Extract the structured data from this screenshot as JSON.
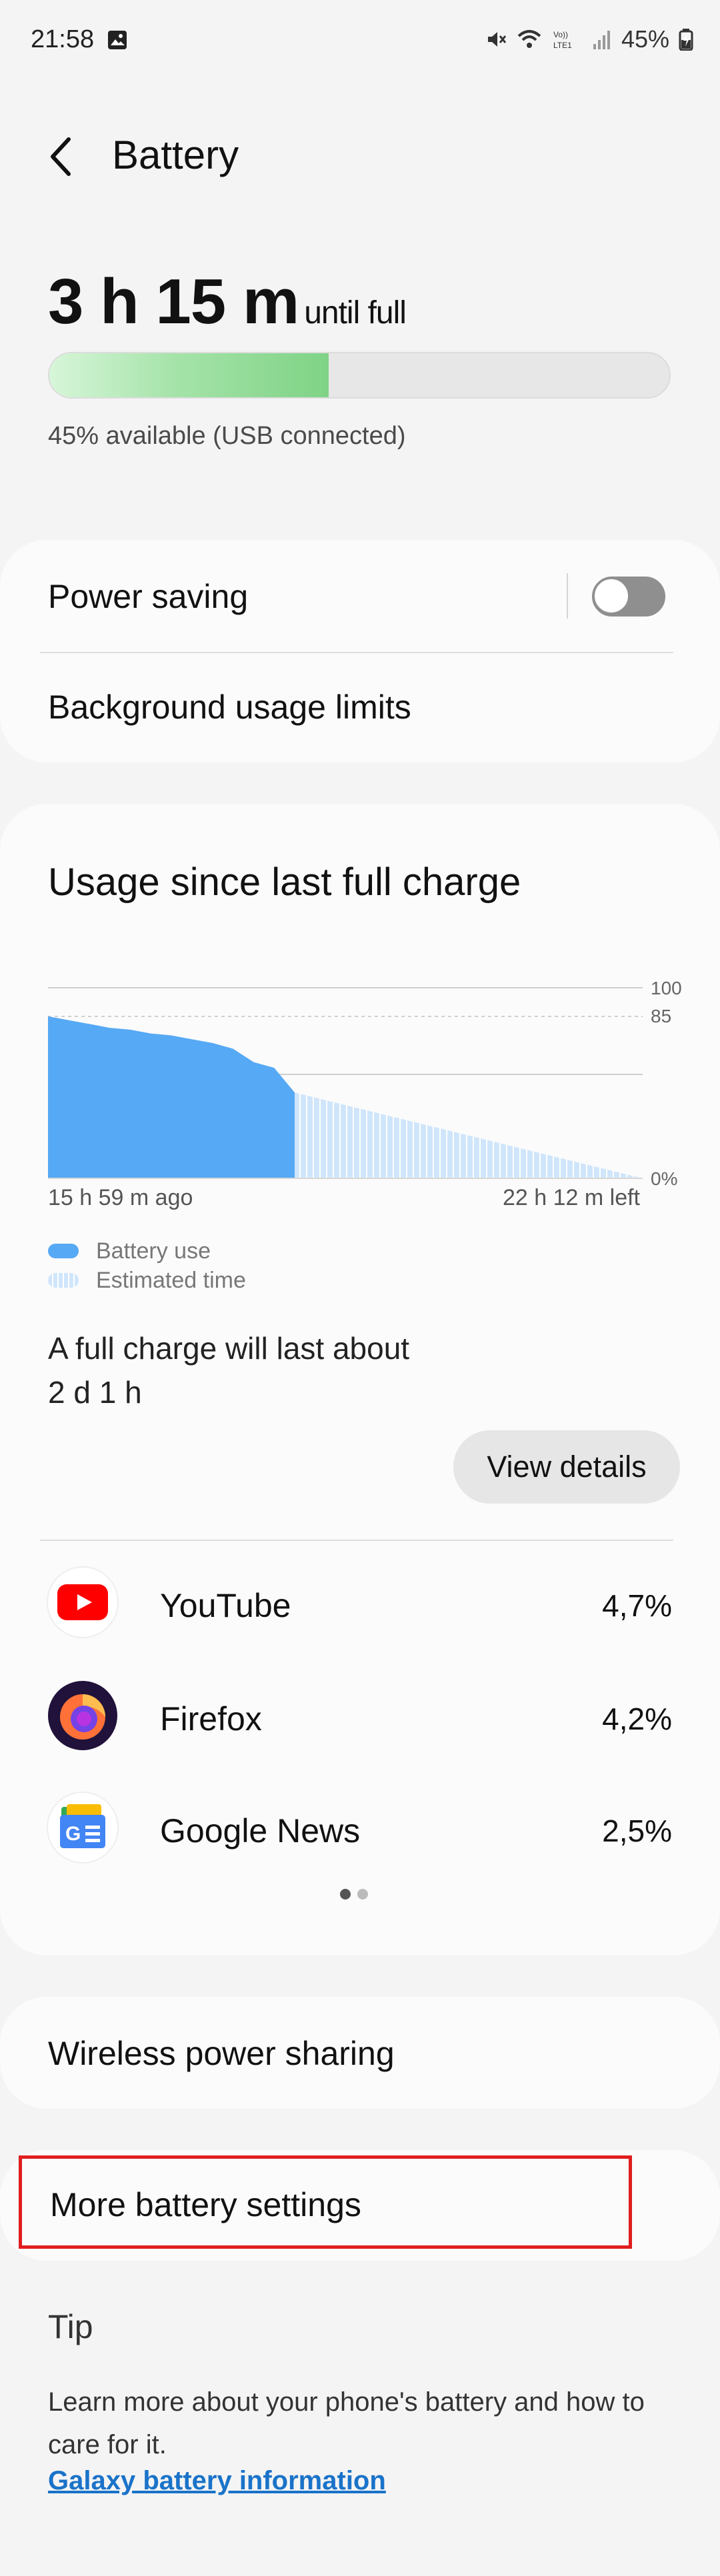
{
  "status_bar": {
    "time": "21:58",
    "battery_pct": "45%"
  },
  "header": {
    "title": "Battery"
  },
  "charge": {
    "time_big": "3 h 15 m",
    "until_full": "until full",
    "level_fraction": 0.45,
    "available_text": "45% available (USB connected)"
  },
  "toggles": {
    "power_saving_label": "Power saving",
    "power_saving_on": false,
    "background_limits_label": "Background usage limits"
  },
  "usage": {
    "title": "Usage since last full charge",
    "full_charge_label": "A full charge will last about",
    "full_charge_value": "2 d 1 h",
    "view_details_label": "View details",
    "legend_battery_use": "Battery use",
    "legend_estimated": "Estimated time",
    "page_index": 0,
    "page_count": 2
  },
  "chart_data": {
    "type": "area",
    "y_ticks": [
      "100",
      "85",
      "0%"
    ],
    "x_start_label": "15 h 59 m ago",
    "x_end_label": "22 h 12 m left",
    "ylim": [
      0,
      100
    ],
    "series": [
      {
        "name": "Battery use",
        "values": [
          85,
          83,
          81,
          79,
          78,
          76,
          75,
          73,
          71,
          68,
          61,
          58,
          45
        ]
      },
      {
        "name": "Estimated time",
        "values": [
          45,
          0
        ]
      }
    ],
    "colors": {
      "battery_use": "#56a9f4",
      "estimated": "#cfe5fb"
    }
  },
  "apps": [
    {
      "name": "YouTube",
      "percent": "4,7%",
      "icon": "youtube-icon"
    },
    {
      "name": "Firefox",
      "percent": "4,2%",
      "icon": "firefox-icon"
    },
    {
      "name": "Google News",
      "percent": "2,5%",
      "icon": "google-news-icon"
    }
  ],
  "wireless": {
    "label": "Wireless power sharing"
  },
  "more_settings": {
    "label": "More battery settings"
  },
  "tip": {
    "title": "Tip",
    "body": "Learn more about your phone's battery and how to care for it.",
    "link": "Galaxy battery information"
  },
  "colors": {
    "accent_link": "#1a73c9",
    "highlight_box": "#e01e1e",
    "battery_fill": "#7fd386"
  }
}
